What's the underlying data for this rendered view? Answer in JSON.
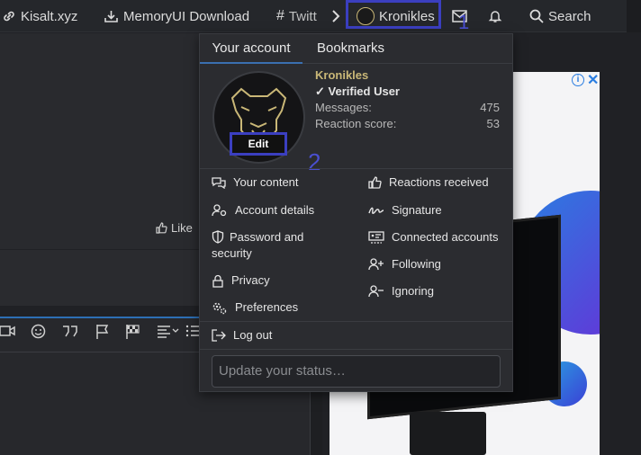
{
  "nav": {
    "kisalt": "Kisalt.xyz",
    "memoryui": "MemoryUI Download",
    "twitter": "Twitt",
    "kronikles": "Kronikles",
    "search": "Search"
  },
  "markers": {
    "one": "1",
    "two": "2"
  },
  "page": {
    "like": "Like"
  },
  "menu": {
    "tabs": [
      "Your account",
      "Bookmarks"
    ],
    "user": {
      "name": "Kronikles",
      "verified": "✓ Verified User",
      "messages_label": "Messages:",
      "messages_value": "475",
      "reaction_label": "Reaction score:",
      "reaction_value": "53",
      "edit": "Edit"
    },
    "left_items": [
      "Your content",
      "Account details",
      "Password and security",
      "Privacy",
      "Preferences"
    ],
    "right_items": [
      "Reactions received",
      "Signature",
      "Connected accounts",
      "Following",
      "Ignoring"
    ],
    "logout": "Log out",
    "status_placeholder": "Update your status…"
  },
  "colors": {
    "accent": "#3b3fc0",
    "username": "#c9b777",
    "tab_underline": "#3a6fb0",
    "ad_blue": "#2a7de1"
  },
  "ad": {
    "icons": [
      "info-icon",
      "close-icon"
    ]
  }
}
